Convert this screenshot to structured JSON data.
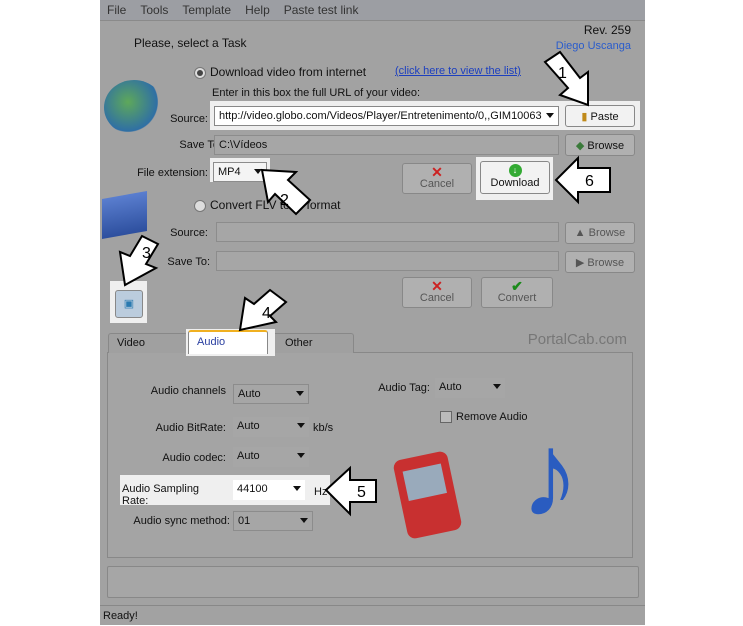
{
  "menu": [
    "File",
    "Tools",
    "Template",
    "Help",
    "Paste test link"
  ],
  "rev": "Rev. 259",
  "author": "Diego Uscanga",
  "task_prompt": "Please, select a Task",
  "download": {
    "radio_label": "Download video from internet",
    "list_link": "(click here to view the list)",
    "instruction": "Enter in this box the full URL of your video:",
    "source_label": "Source:",
    "source_value": "http://video.globo.com/Videos/Player/Entretenimento/0,,GIM10063",
    "paste": "Paste",
    "saveto_label": "Save To:",
    "saveto_value": "C:\\Vídeos",
    "browse": "Browse",
    "ext_label": "File extension:",
    "ext_value": "MP4",
    "cancel": "Cancel",
    "download": "Download"
  },
  "convert": {
    "radio_label": "Convert FLV to ... format",
    "source_label": "Source:",
    "saveto_label": "Save To:",
    "browse": "Browse",
    "cancel": "Cancel",
    "convert": "Convert"
  },
  "tabs": [
    "Video",
    "Audio",
    "Other"
  ],
  "watermark": "PortalCab.com",
  "audio": {
    "channels_label": "Audio channels",
    "channels": "Auto",
    "bitrate_label": "Audio BitRate:",
    "bitrate": "Auto",
    "bitrate_unit": "kb/s",
    "codec_label": "Audio codec:",
    "codec": "Auto",
    "sampling_label": "Audio Sampling Rate:",
    "sampling": "44100",
    "sampling_unit": "Hz",
    "sync_label": "Audio sync method:",
    "sync": "01",
    "tag_label": "Audio Tag:",
    "tag": "Auto",
    "remove": "Remove Audio"
  },
  "status": "Ready!",
  "callouts": [
    "1",
    "2",
    "3",
    "4",
    "5",
    "6"
  ]
}
